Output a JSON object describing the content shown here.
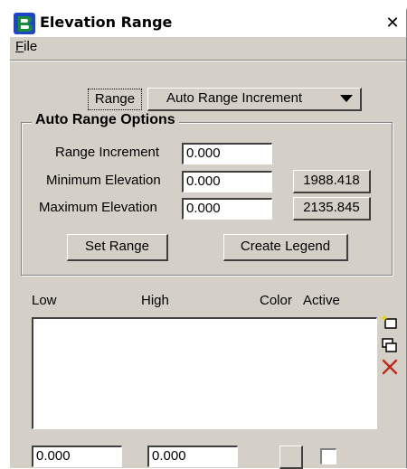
{
  "window": {
    "title": "Elevation Range",
    "close_glyph": "✕",
    "app_icon": "bentley-b-logo-icon"
  },
  "menu": {
    "file_label": "File",
    "file_mnemonic": "F",
    "file_rest": "ile"
  },
  "range": {
    "label": "Range",
    "selected": "Auto Range Increment"
  },
  "auto_range_options": {
    "title": "Auto Range Options",
    "range_increment_label": "Range Increment",
    "range_increment_value": "0.000",
    "minimum_elevation_label": "Minimum Elevation",
    "minimum_elevation_value": "0.000",
    "minimum_elevation_button": "1988.418",
    "maximum_elevation_label": "Maximum Elevation",
    "maximum_elevation_value": "0.000",
    "maximum_elevation_button": "2135.845",
    "set_range_button": "Set Range",
    "create_legend_button": "Create Legend"
  },
  "list": {
    "columns": [
      "Low",
      "High",
      "Color",
      "Active"
    ],
    "rows": []
  },
  "side_icons": [
    "add-row-icon",
    "copy-row-icon",
    "delete-row-icon"
  ],
  "edit_row": {
    "low_value": "0.000",
    "high_value": "0.000",
    "active_checked": false
  },
  "colors": {
    "dialog_face": "#d4d0c8",
    "logo_green": "#1b8a3a",
    "logo_blue": "#1f46c8",
    "delete_red": "#c0281c",
    "add_yellow": "#f2d200"
  }
}
